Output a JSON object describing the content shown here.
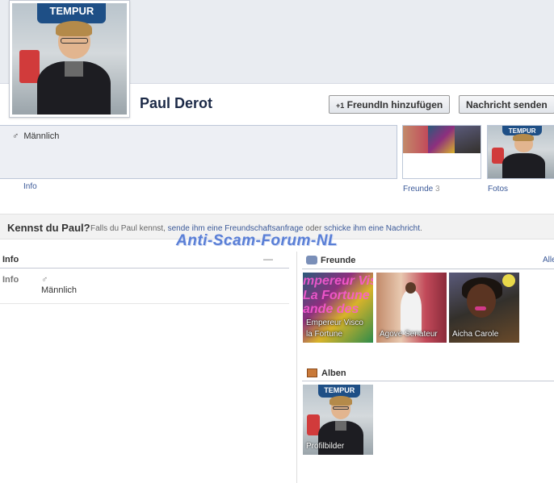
{
  "profile": {
    "name": "Paul Derot",
    "photo_sign": "TEMPUR",
    "add_friend_label": "FreundIn hinzufügen",
    "add_friend_icon": "+1",
    "message_label": "Nachricht senden"
  },
  "summary": {
    "gender_symbol": "♂",
    "gender": "Männlich",
    "info_tab": "Info",
    "friends_tab": "Freunde",
    "friends_count": "3",
    "photos_tab": "Fotos"
  },
  "prompt": {
    "question": "Kennst du Paul?",
    "text_prefix": "Falls du Paul kennst,",
    "link_request": "sende ihm eine Freundschaftsanfrage",
    "text_or": "oder",
    "link_message": "schicke ihm eine Nachricht",
    "text_suffix": "."
  },
  "watermark": "Anti-Scam-Forum-NL",
  "info_section": {
    "title": "Info",
    "edit_glyph": "—",
    "row_label": "Info",
    "row_symbol": "♂",
    "row_value": "Männlich"
  },
  "friends_section": {
    "title": "Freunde",
    "see_all": "Alle",
    "icon": "friends-icon",
    "friends": [
      {
        "name": "Empereur Visco la Fortune",
        "overlay": "mpereur Vis\nLa Fortune\nande des"
      },
      {
        "name": "Agove Senateur"
      },
      {
        "name": "Aicha Carole"
      }
    ]
  },
  "albums_section": {
    "title": "Alben",
    "icon": "album-icon",
    "albums": [
      {
        "name": "Profilbilder"
      }
    ]
  },
  "colors": {
    "link": "#3b5998",
    "name": "#1c2a47",
    "watermark": "#5a7fd6"
  }
}
